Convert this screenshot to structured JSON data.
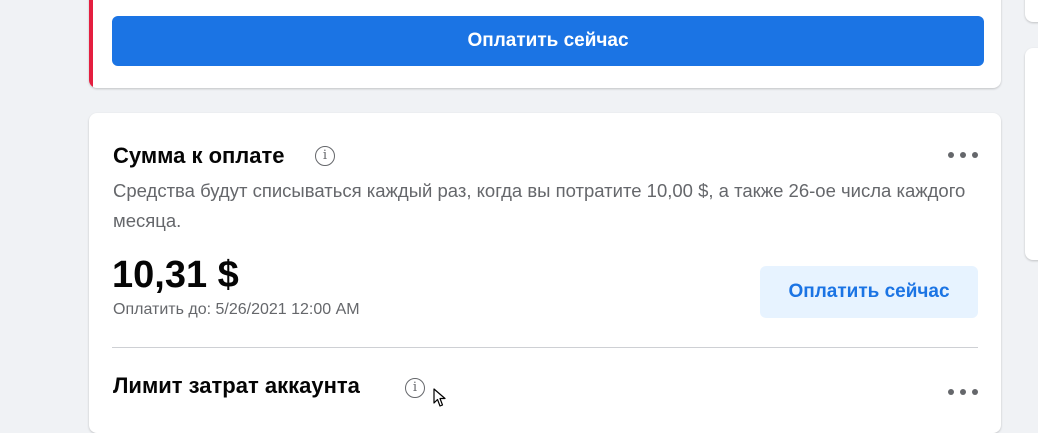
{
  "alert": {
    "pay_now_label": "Оплатить сейчас"
  },
  "amount_due": {
    "title": "Сумма к оплате",
    "info_glyph": "i",
    "description": "Средства будут списываться каждый раз, когда вы потратите 10,00 $, а также 26-ое числа каждого месяца.",
    "amount": "10,31 $",
    "due_date": "Оплатить до: 5/26/2021 12:00 AM",
    "pay_now_label": "Оплатить сейчас"
  },
  "spending_limit": {
    "title": "Лимит затрат аккаунта",
    "info_glyph": "i"
  },
  "colors": {
    "primary": "#1b74e4",
    "primary_light": "#e7f3ff",
    "alert_stripe": "#e41e3f",
    "text_secondary": "#65676b",
    "background": "#f0f2f5"
  },
  "icons": [
    "info-icon",
    "more-options-icon",
    "mouse-cursor-icon"
  ]
}
